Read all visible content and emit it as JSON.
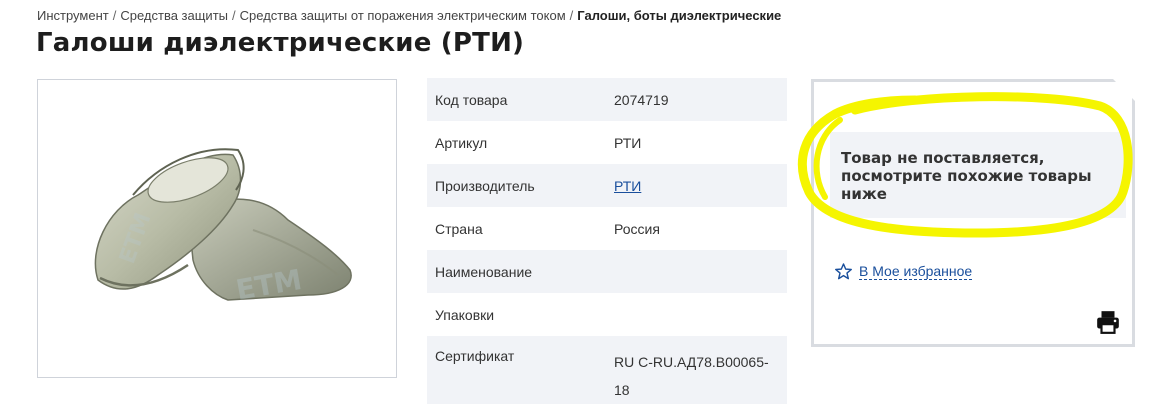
{
  "breadcrumb": {
    "items": [
      "Инструмент",
      "Средства защиты",
      "Средства защиты от поражения электрическим током"
    ],
    "current": "Галоши, боты диэлектрические",
    "separator": "/"
  },
  "page_title": "Галоши диэлектрические (РТИ)",
  "product_image": {
    "alt": "Галоши диэлектрические",
    "watermark": "ETM"
  },
  "specs": [
    {
      "key": "Код товара",
      "value": "2074719"
    },
    {
      "key": "Артикул",
      "value": "РТИ"
    },
    {
      "key": "Производитель",
      "value": "РТИ"
    },
    {
      "key": "Страна",
      "value": "Россия"
    },
    {
      "key": "Наименование",
      "value": ""
    },
    {
      "key": "Упаковки",
      "value": ""
    },
    {
      "key": "Сертификат",
      "value": "RU C-RU.АД78.B00065-18"
    }
  ],
  "side_card": {
    "notice_line1": "Товар не поставляется,",
    "notice_line2": "посмотрите похожие товары",
    "notice_line3": "ниже",
    "favorite_label": "В Мое избранное"
  },
  "icons": {
    "favorite": "star-outline-icon",
    "print": "printer-icon"
  },
  "colors": {
    "link": "#1a4f9c",
    "highlight": "#f5f500",
    "stripe": "#f1f3f7",
    "card_border": "#d9dce1"
  }
}
